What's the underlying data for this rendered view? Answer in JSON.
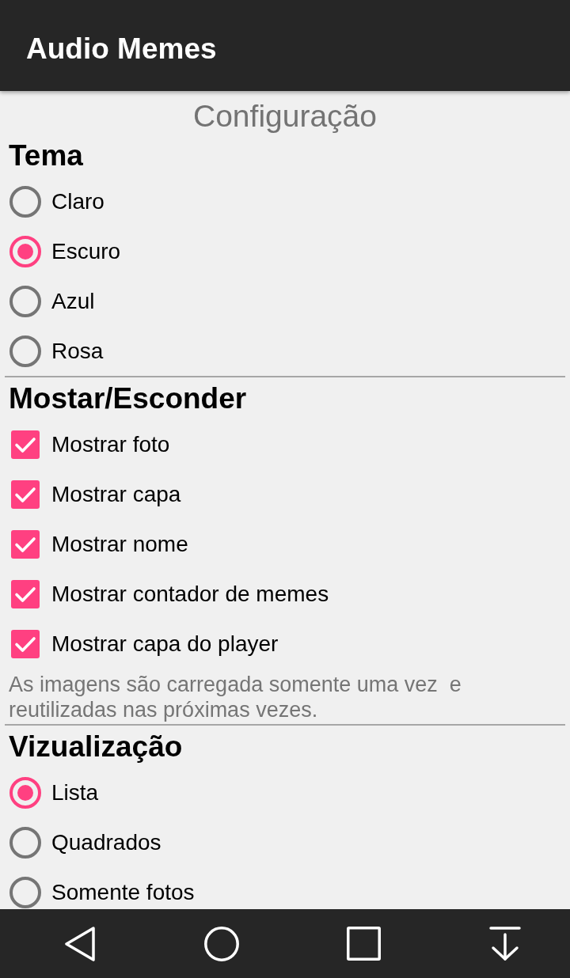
{
  "app_bar": {
    "title": "Audio Memes"
  },
  "page_title": "Configuração",
  "sections": [
    {
      "heading": "Tema",
      "kind": "radio",
      "options": [
        {
          "label": "Claro",
          "selected": false
        },
        {
          "label": "Escuro",
          "selected": true
        },
        {
          "label": "Azul",
          "selected": false
        },
        {
          "label": "Rosa",
          "selected": false
        }
      ]
    },
    {
      "heading": "Mostar/Esconder",
      "kind": "checkbox",
      "options": [
        {
          "label": "Mostrar foto",
          "checked": true
        },
        {
          "label": "Mostrar capa",
          "checked": true
        },
        {
          "label": "Mostrar nome",
          "checked": true
        },
        {
          "label": "Mostrar contador de memes",
          "checked": true
        },
        {
          "label": "Mostrar capa do player",
          "checked": true
        }
      ],
      "note": "As imagens são carregada somente uma vez  e reutilizadas nas próximas vezes."
    },
    {
      "heading": "Vizualização",
      "kind": "radio",
      "options": [
        {
          "label": "Lista",
          "selected": true
        },
        {
          "label": "Quadrados",
          "selected": false
        },
        {
          "label": "Somente fotos",
          "selected": false
        }
      ]
    }
  ]
}
